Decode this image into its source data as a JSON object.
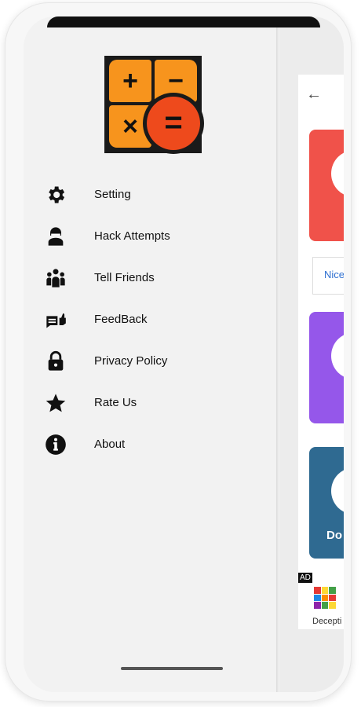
{
  "app": {
    "logo_name": "calculator-vault-logo",
    "logo_symbols": {
      "plus": "+",
      "minus": "−",
      "times": "×",
      "equals": "="
    }
  },
  "drawer": {
    "items": [
      {
        "label": "Setting",
        "icon": "gear-icon"
      },
      {
        "label": "Hack Attempts",
        "icon": "hacker-icon"
      },
      {
        "label": "Tell Friends",
        "icon": "people-icon"
      },
      {
        "label": "FeedBack",
        "icon": "feedback-icon"
      },
      {
        "label": "Privacy Policy",
        "icon": "lock-icon"
      },
      {
        "label": "Rate Us",
        "icon": "star-icon"
      },
      {
        "label": "About",
        "icon": "info-icon"
      }
    ]
  },
  "background": {
    "back_icon": "←",
    "nice_text": "Nice",
    "card3_text": "Do",
    "ad_badge": "AD",
    "deceptive_text": "Decepti"
  },
  "colors": {
    "card1": "#f0524a",
    "card2": "#9557ea",
    "card3": "#2f6a91",
    "logo_orange": "#f7941d",
    "logo_red": "#ee4a1c"
  }
}
